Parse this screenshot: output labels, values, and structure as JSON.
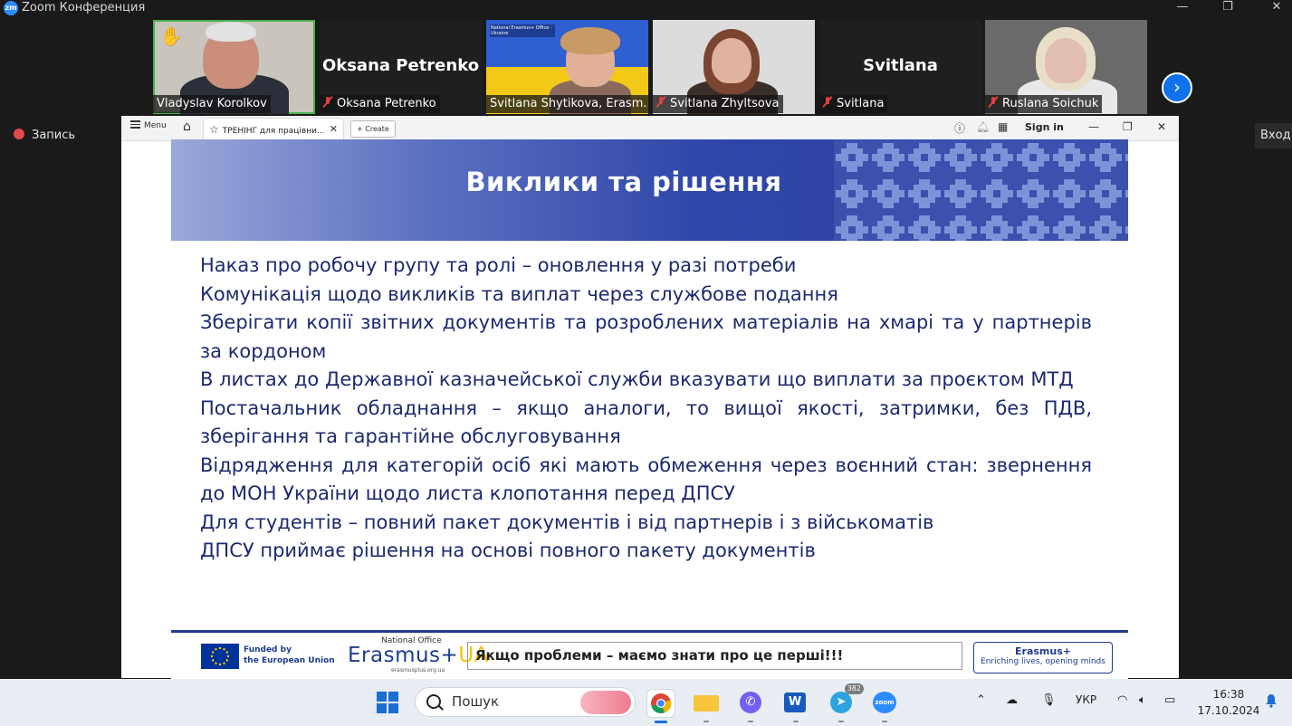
{
  "window": {
    "title": "Zoom Конференция",
    "logo_text": "zm"
  },
  "participants": [
    {
      "name": "Vladyslav Korolkov",
      "hand_raised": true,
      "muted": false,
      "active": true
    },
    {
      "name": "Oksana Petrenko",
      "display_name": "Oksana Petrenko",
      "muted": true
    },
    {
      "name": "Svitlana Shytikova, Erasm...",
      "muted": false
    },
    {
      "name": "Svitlana Zhyltsova",
      "muted": true
    },
    {
      "name": "Svitlana",
      "display_name": "Svitlana",
      "muted": true
    },
    {
      "name": "Ruslana Soichuk",
      "muted": true
    }
  ],
  "record_label": "Запись",
  "login_label": "Вход",
  "browser": {
    "menu_label": "Menu",
    "tab_title": "ТРЕНІНГ для працівни...",
    "create_label": "Create",
    "sign_in_label": "Sign in"
  },
  "slide": {
    "title": "Виклики та рішення",
    "lines": [
      "Наказ про робочу групу та ролі – оновлення у разі потреби",
      "Комунікація щодо викликів та виплат через службове подання",
      "Зберігати копії звітних документів та розроблених матеріалів на хмарі та у партнерів за кордоном",
      "В листах до Державної казначейської служби вказувати що виплати за проєктом МТД",
      "Постачальник обладнання – якщо аналоги, то вищої якості, затримки, без ПДВ, зберігання та гарантійне обслуговування",
      "Відрядження для категорій осіб які мають обмеження через воєнний стан: звернення до МОН України щодо листа клопотання перед ДПСУ",
      "Для студентів – повний пакет документів і від партнерів і з військоматів",
      "ДПСУ приймає рішення на основі повного пакету документів"
    ],
    "footer": {
      "eu_line1": "Funded by",
      "eu_line2": "the European Union",
      "national_office": "National Office",
      "erasmus_text": "Erasmus+",
      "erasmus_ua": "UA",
      "erasmus_url": "erasmusplus.org.ua",
      "problem_text": "Якщо проблеми – маємо знати про це перші!!!",
      "erasmus_box_title": "Erasmus+",
      "erasmus_box_tagline": "Enriching lives, opening minds"
    }
  },
  "taskbar": {
    "search_label": "Пошук",
    "telegram_badge": "382",
    "language": "УКР",
    "time": "16:38",
    "date": "17.10.2024"
  },
  "colors": {
    "zoom_blue": "#2D8CFF",
    "slide_text": "#1c2a6e",
    "slide_header": "#2f47a8",
    "mute_red": "#e04040"
  }
}
